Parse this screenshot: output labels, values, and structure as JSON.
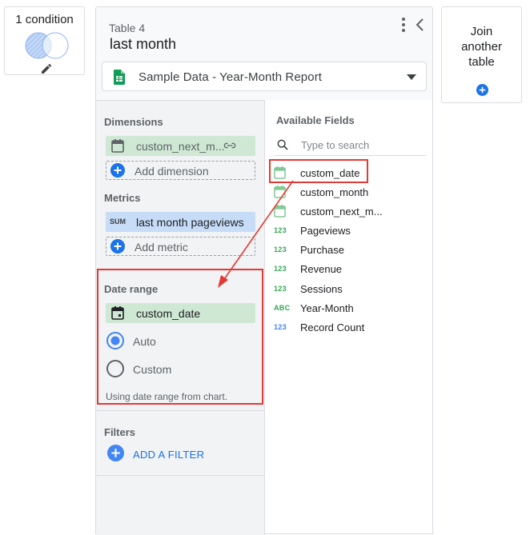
{
  "condition_card": {
    "label": "1 condition",
    "venn_icon": "venn-diagram-icon",
    "edit_icon": "pencil-icon"
  },
  "join_card": {
    "label": "Join another table",
    "add_icon": "plus-circle-icon"
  },
  "panel": {
    "table_name": "Table 4",
    "table_title": "last month",
    "menu_icon": "more-vert-icon",
    "collapse_icon": "chevron-left-icon",
    "data_source": {
      "icon": "sheets-icon",
      "label": "Sample Data - Year-Month Report",
      "caret_icon": "caret-down-icon"
    }
  },
  "dimensions": {
    "title": "Dimensions",
    "items": [
      {
        "label": "custom_next_m...",
        "icon": "calendar-icon",
        "link_icon": "link-icon"
      }
    ],
    "add_label": "Add dimension"
  },
  "metrics": {
    "title": "Metrics",
    "items": [
      {
        "agg": "SUM",
        "label": "last month pageviews"
      }
    ],
    "add_label": "Add metric"
  },
  "date_range": {
    "title": "Date range",
    "field": {
      "label": "custom_date",
      "icon": "calendar-icon"
    },
    "options": [
      {
        "label": "Auto",
        "selected": true
      },
      {
        "label": "Custom",
        "selected": false
      }
    ],
    "hint": "Using date range from chart."
  },
  "filters": {
    "title": "Filters",
    "add_label": "ADD A FILTER"
  },
  "available_fields": {
    "title": "Available Fields",
    "search_placeholder": "Type to search",
    "items": [
      {
        "label": "custom_date",
        "type": "date",
        "icon": "calendar-icon"
      },
      {
        "label": "custom_month",
        "type": "date",
        "icon": "calendar-icon"
      },
      {
        "label": "custom_next_m...",
        "type": "date",
        "icon": "calendar-icon"
      },
      {
        "label": "Pageviews",
        "type": "123"
      },
      {
        "label": "Purchase",
        "type": "123"
      },
      {
        "label": "Revenue",
        "type": "123"
      },
      {
        "label": "Sessions",
        "type": "123"
      },
      {
        "label": "Year-Month",
        "type": "ABC"
      },
      {
        "label": "Record Count",
        "type": "123"
      }
    ]
  },
  "colors": {
    "dimension_chip": "#cfe8d4",
    "metric_chip": "#c6dcf7",
    "accent_blue": "#1a73e8",
    "annotation_red": "#e53935",
    "field_type_green": "#34a853"
  }
}
